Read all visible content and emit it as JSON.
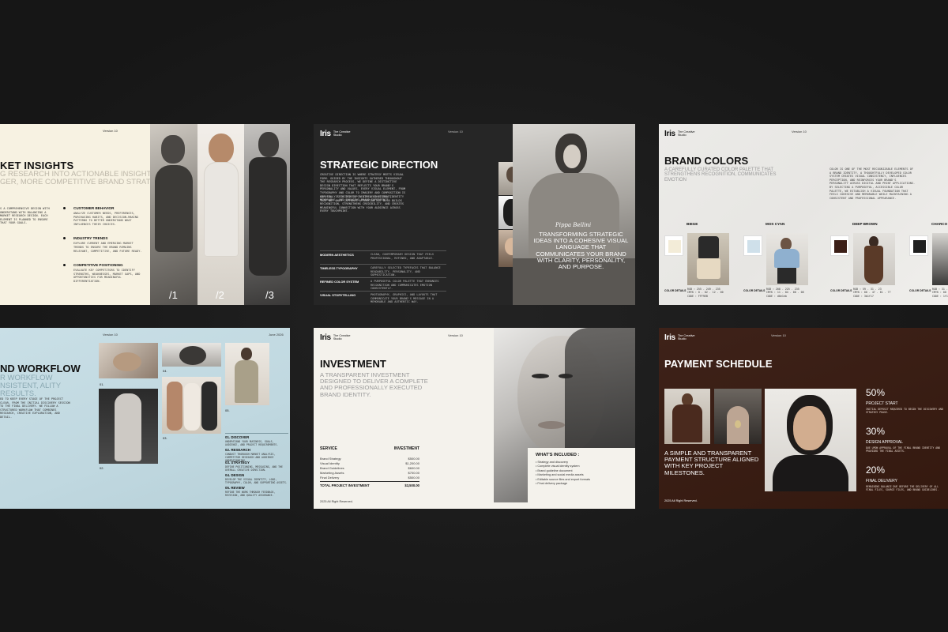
{
  "brand": {
    "mark": "Iris",
    "sub": "The Creative Studio"
  },
  "version": "Version 10",
  "date": "June 2026",
  "footer": "2025 All Right Reserved.",
  "s1": {
    "title": "KET INSIGHTS",
    "subtitle": "G RESEARCH INTO ACTIONABLE INSIGHTS THAT SHAPE GER, MORE COMPETITIVE BRAND STRATEGY.",
    "left_text": "S A COMPREHENSIVE DESIGN WITH UNDERSTAND WITH BALANCING A MARKET RESEARCH DESIGN. EACH ELEMENT IS PLANNED TO ENSURE THAT YOUR GOALS.",
    "items": [
      {
        "h": "CUSTOMER BEHAVIOR",
        "t": "ANALYZE CUSTOMER NEEDS, PREFERENCES, PURCHASING HABITS, AND DECISION-MAKING PATTERNS TO BETTER UNDERSTAND WHAT INFLUENCES THEIR CHOICES."
      },
      {
        "h": "INDUSTRY TRENDS",
        "t": "EXPLORE CURRENT AND EMERGING MARKET TRENDS TO ENSURE THE BRAND REMAINS RELEVANT, COMPETITIVE, AND FUTURE READY."
      },
      {
        "h": "COMPETITIVE POSITIONING",
        "t": "EVALUATE KEY COMPETITORS TO IDENTIFY STRENGTHS, WEAKNESSES, MARKET GAPS, AND OPPORTUNITIES FOR MEANINGFUL DIFFERENTIATION."
      }
    ],
    "n1": "/1",
    "n2": "/2",
    "n3": "/3"
  },
  "s2": {
    "title": "STRATEGIC DIRECTION",
    "p1": "CREATIVE DIRECTION IS WHERE STRATEGY MEETS VISUAL FORM. GUIDED BY THE INSIGHTS GATHERED THROUGHOUT THE RESEARCH PROCESS, WE DEFINE A DISTINCTIVE DESIGN DIRECTION THAT REFLECTS YOUR BRAND'S PERSONALITY AND VALUES. EVERY VISUAL ELEMENT, FROM TYPOGRAPHY AND COLOR TO IMAGERY AND COMPOSITION IS CAREFULLY SELECTED TO CREATE A CONSISTENT, MEMORABLE, AND ENGAGING BRAND EXPERIENCE.",
    "p2": "OUR GOAL IS TO DEVELOP A TIMELESS VISUAL IDENTITY THAT NOT ONLY CAPTURES ATTENTION BUT ALSO BUILDS RECOGNITION, STRENGTHENS CREDIBILITY, AND CREATES MEANINGFUL CONNECTION WITH YOUR AUDIENCE ACROSS EVERY TOUCHPOINT.",
    "rows": [
      {
        "k": "MODERN AESTHETICS",
        "v": "CLEAN, CONTEMPORARY DESIGN THAT FEELS PROFESSIONAL, REFINED, AND ADAPTABLE."
      },
      {
        "k": "TIMELESS TYPOGRAPHY",
        "v": "CAREFULLY SELECTED TYPEFACES THAT BALANCE READABILITY, PERSONALITY, AND SOPHISTICATION."
      },
      {
        "k": "REFINED COLOR SYSTEM",
        "v": "A PURPOSEFUL COLOR PALETTE THAT ENHANCES RECOGNITION AND COMMUNICATES EMOTION CONSISTENTLY."
      },
      {
        "k": "VISUAL STORYTELLING",
        "v": "PHOTOGRAPHY, GRAPHICS, AND LAYOUTS THAT COMMUNICATE YOUR BRAND'S MESSAGE IN A MEMORABLE AND AUTHENTIC WAY."
      }
    ],
    "quote": "TRANSFORMING STRATEGIC IDEAS INTO A COHESIVE VISUAL LANGUAGE THAT COMMUNICATES YOUR BRAND WITH CLARITY, PERSONALITY, AND PURPOSE.",
    "signature": "Pippa Bellini"
  },
  "s3": {
    "title": "BRAND COLORS",
    "subtitle": "A CAREFULLY CURATED COLOR PALETTE THAT STRENGTHENS RECOGNITION, COMMUNICATES EMOTION",
    "body": "COLOR IS ONE OF THE MOST RECOGNIZABLE ELEMENTS OF A BRAND IDENTITY. A THOUGHTFULLY DEVELOPED COLOR SYSTEM CREATES VISUAL CONSISTENCY, INFLUENCES PERCEPTION, AND REINFORCES YOUR BRAND'S PERSONALITY ACROSS DIGITAL AND PRINT APPLICATIONS. BY SELECTING A PURPOSEFUL, ACCESSIBLE COLOR PALETTE, WE ESTABLISH A VISUAL FOUNDATION THAT FEELS COHESIVE AND MEMORABLE WHILE MAINTAINING A CONSISTENT AND PROFESSIONAL APPEARANCE.",
    "colors": [
      {
        "name": "BIEGE",
        "hex": "#f3ecd8",
        "details": "COLOR DETAILS",
        "rgb": "RGB :  255 . 249 . 235",
        "cmyk": "CMYK :  0 . 02 . 12 . 00",
        "code": "CODE :  FFF9EB"
      },
      {
        "name": "MOS CYAN",
        "hex": "#cfe0ea",
        "details": "COLOR DETAILS",
        "rgb": "RGB :  208 . 225 . 235",
        "cmyk": "CMYK :  11 . 04 . 00 . 08",
        "code": "CODE :  d0e1eb"
      },
      {
        "name": "DEEP BROWN",
        "hex": "#3b1f17",
        "details": "COLOR DETAILS",
        "rgb": "RGB :  59 . 31 . 23",
        "cmyk": "CMYK :  00 . 47 . 61 . 77",
        "code": "CODE :  3b1f17"
      },
      {
        "name": "CHARCO",
        "hex": "#1f1f1f",
        "details": "COLOR DETAILS",
        "rgb": "RGB :  31 . 31 . 31",
        "cmyk": "CMYK :  00 . 00 . 00",
        "code": "CODE :  1f1f1f"
      }
    ]
  },
  "s4": {
    "title": "ND WORKFLOW",
    "subtitle": "R WORKFLOW NSISTENT, ALITY RESULTS.",
    "left_text": "ED TO KEEP EVERY STAGE OF THE PROJECT CLEAR, FROM THE INITIAL DISCOVERY SESSION TO THE FINAL DELIVERY. WE FOLLOW A STRUCTURED WORKFLOW THAT COMBINES RESEARCH, CREATIVE EXPLORATION, AND DETAIL.",
    "nums": [
      "01.",
      "02.",
      "03.",
      "04.",
      "05."
    ],
    "steps": [
      {
        "h": "01. DISCOVER",
        "t": "UNDERSTAND YOUR BUSINESS, GOALS, AUDIENCE, AND PROJECT REQUIREMENTS."
      },
      {
        "h": "02. RESEARCH",
        "t": "CONDUCT THOROUGH MARKET ANALYSIS, COMPETITOR RESEARCH AND AUDIENCE UNDERSTANDING."
      },
      {
        "h": "03. STRATEGY",
        "t": "DEFINE POSITIONING, MESSAGING, AND THE OVERALL CREATIVE DIRECTION."
      },
      {
        "h": "04. DESIGN",
        "t": "DEVELOP THE VISUAL IDENTITY, LOGO, TYPOGRAPHY, COLOR, AND SUPPORTING ASSETS."
      },
      {
        "h": "05. REVIEW",
        "t": "REFINE THE WORK THROUGH FEEDBACK, REVISION, AND QUALITY ASSURANCE."
      }
    ]
  },
  "s5": {
    "title": "INVESTMENT",
    "subtitle": "A TRANSPARENT INVESTMENT DESIGNED TO DELIVER A COMPLETE AND PROFESSIONALLY EXECUTED BRAND IDENTITY.",
    "col1": "SERVICE",
    "col2": "INVESTMENT",
    "rows": [
      {
        "s": "Brand Strategy",
        "v": "$500.00"
      },
      {
        "s": "Visual Identity",
        "v": "$1,200.00"
      },
      {
        "s": "Brand Guidelines",
        "v": "$600.00"
      },
      {
        "s": "Marketing Assets",
        "v": "$700.00"
      },
      {
        "s": "Final Delivery",
        "v": "$500.00"
      }
    ],
    "total_label": "TOTAL PROJECT INVESTMENT",
    "total": "$3,500.00",
    "included_title": "WHAT'S INCLUDED :",
    "included": [
      "Strategy and discovery",
      "Complete visual identity system",
      "Brand guideline document",
      "Marketing and social media assets",
      "Editable source files and export formats",
      "Final delivery package"
    ]
  },
  "s6": {
    "title": "PAYMENT SCHEDULE",
    "subtitle": "A SIMPLE AND TRANSPARENT PAYMENT STRUCTURE ALIGNED WITH KEY PROJECT MILESTONES.",
    "steps": [
      {
        "pct": "50%",
        "h": "PROJECT START",
        "t": "INITIAL DEPOSIT REQUIRED TO BEGIN THE DISCOVERY AND STRATEGY PHASE."
      },
      {
        "pct": "30%",
        "h": "DESIGN APPROVAL",
        "t": "DUE UPON APPROVAL OF THE FINAL BRAND IDENTITY AND PROVIDED THE FINAL ASSETS."
      },
      {
        "pct": "20%",
        "h": "FINAL DELIVERY",
        "t": "REMAINING BALANCE DUE BEFORE THE DELIVERY OF ALL FINAL FILES, SOURCE FILES, AND BRAND GUIDELINES."
      }
    ]
  }
}
